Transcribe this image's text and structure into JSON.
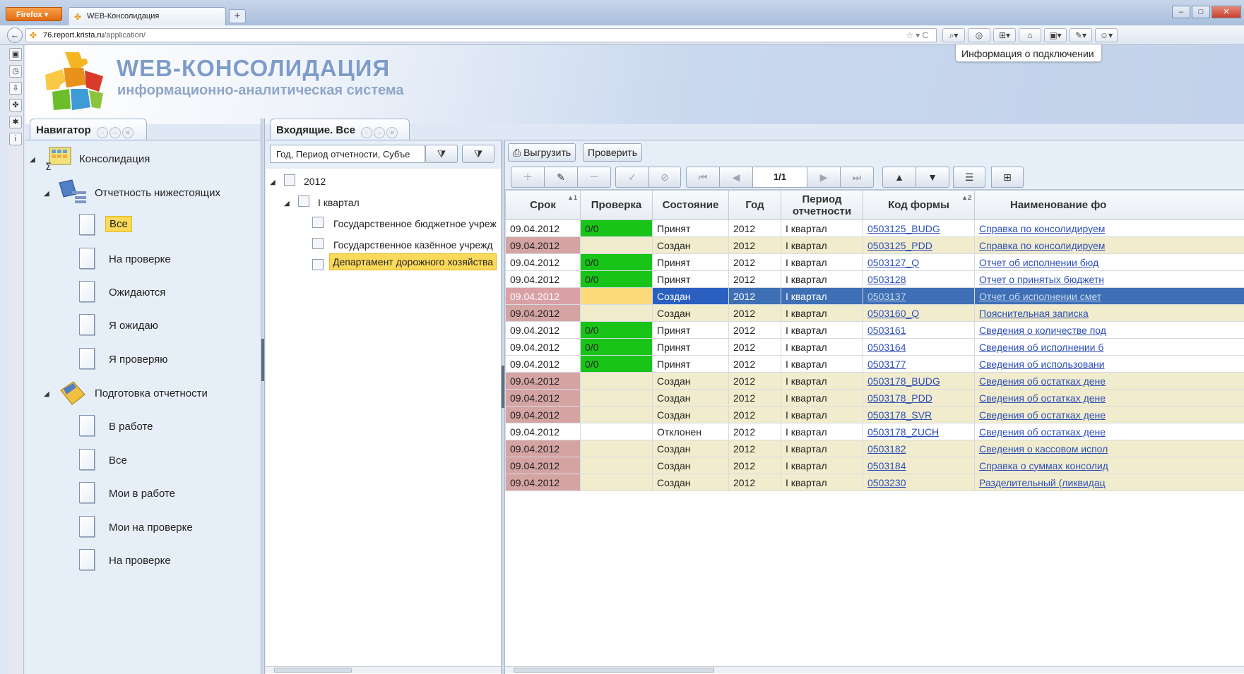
{
  "browser": {
    "menu_label": "Firefox",
    "tab_title": "WEB-Консолидация",
    "new_tab": "+",
    "url_host": "76.report.krista.ru",
    "url_path": "/application/",
    "url_prefix": ""
  },
  "app": {
    "title": "WEB-КОНСОЛИДАЦИЯ",
    "subtitle": "информационно-аналитическая система",
    "connection_info": "Информация о подключении"
  },
  "navigator": {
    "tab_title": "Навигатор",
    "root": "Консолидация",
    "group1": "Отчетность нижестоящих",
    "group1_items": [
      "Все",
      "На проверке",
      "Ожидаются",
      "Я ожидаю",
      "Я проверяю"
    ],
    "group2": "Подготовка отчетности",
    "group2_items": [
      "В работе",
      "Все",
      "Мои в работе",
      "Мои на проверке",
      "На проверке"
    ]
  },
  "incoming": {
    "tab_title": "Входящие. Все",
    "filter_value": "Год, Период отчетности, Субъе",
    "tree_year": "2012",
    "tree_quarter": "I квартал",
    "tree_items": [
      "Государственное бюджетное учреж",
      "Государственное казённое учрежд",
      "Департамент дорожного хозяйства"
    ]
  },
  "grid": {
    "export_label": "Выгрузить",
    "check_label": "Проверить",
    "pager": "1/1",
    "columns": [
      "Срок",
      "Проверка",
      "Состояние",
      "Год",
      "Период отчетности",
      "Код формы",
      "Наименование фо"
    ],
    "rows": [
      {
        "deadline": "09.04.2012",
        "check": "0/0",
        "state": "Принят",
        "year": "2012",
        "period": "I квартал",
        "code": "0503125_BUDG",
        "name": "Справка по консолидируем"
      },
      {
        "deadline": "09.04.2012",
        "check": "",
        "state": "Создан",
        "year": "2012",
        "period": "I квартал",
        "code": "0503125_PDD",
        "name": "Справка по консолидируем"
      },
      {
        "deadline": "09.04.2012",
        "check": "0/0",
        "state": "Принят",
        "year": "2012",
        "period": "I квартал",
        "code": "0503127_Q",
        "name": "Отчет об исполнении бюд"
      },
      {
        "deadline": "09.04.2012",
        "check": "0/0",
        "state": "Принят",
        "year": "2012",
        "period": "I квартал",
        "code": "0503128",
        "name": "Отчет о принятых бюджетн"
      },
      {
        "deadline": "09.04.2012",
        "check": "",
        "state": "Создан",
        "year": "2012",
        "period": "I квартал",
        "code": "0503137",
        "name": "Отчет об исполнении смет"
      },
      {
        "deadline": "09.04.2012",
        "check": "",
        "state": "Создан",
        "year": "2012",
        "period": "I квартал",
        "code": "0503160_Q",
        "name": "Пояснительная записка"
      },
      {
        "deadline": "09.04.2012",
        "check": "0/0",
        "state": "Принят",
        "year": "2012",
        "period": "I квартал",
        "code": "0503161",
        "name": "Сведения о количестве под"
      },
      {
        "deadline": "09.04.2012",
        "check": "0/0",
        "state": "Принят",
        "year": "2012",
        "period": "I квартал",
        "code": "0503164",
        "name": "Сведения об исполнении б"
      },
      {
        "deadline": "09.04.2012",
        "check": "0/0",
        "state": "Принят",
        "year": "2012",
        "period": "I квартал",
        "code": "0503177",
        "name": "Сведения об использовани"
      },
      {
        "deadline": "09.04.2012",
        "check": "",
        "state": "Создан",
        "year": "2012",
        "period": "I квартал",
        "code": "0503178_BUDG",
        "name": "Сведения об остатках дене"
      },
      {
        "deadline": "09.04.2012",
        "check": "",
        "state": "Создан",
        "year": "2012",
        "period": "I квартал",
        "code": "0503178_PDD",
        "name": "Сведения об остатках дене"
      },
      {
        "deadline": "09.04.2012",
        "check": "",
        "state": "Создан",
        "year": "2012",
        "period": "I квартал",
        "code": "0503178_SVR",
        "name": "Сведения об остатках дене"
      },
      {
        "deadline": "09.04.2012",
        "check": "",
        "state": "Отклонен",
        "year": "2012",
        "period": "I квартал",
        "code": "0503178_ZUCH",
        "name": "Сведения об остатках дене"
      },
      {
        "deadline": "09.04.2012",
        "check": "",
        "state": "Создан",
        "year": "2012",
        "period": "I квартал",
        "code": "0503182",
        "name": "Сведения о кассовом испол"
      },
      {
        "deadline": "09.04.2012",
        "check": "",
        "state": "Создан",
        "year": "2012",
        "period": "I квартал",
        "code": "0503184",
        "name": "Справка о суммах консолид"
      },
      {
        "deadline": "09.04.2012",
        "check": "",
        "state": "Создан",
        "year": "2012",
        "period": "I квартал",
        "code": "0503230",
        "name": "Разделительный (ликвидац"
      }
    ],
    "selected_row": 4
  },
  "colors": {
    "ok": "#19c419",
    "late": "#d4a4a2",
    "alt_row": "#f1eccd",
    "selection": "#3f6fb5",
    "highlight": "#fbd95a"
  }
}
